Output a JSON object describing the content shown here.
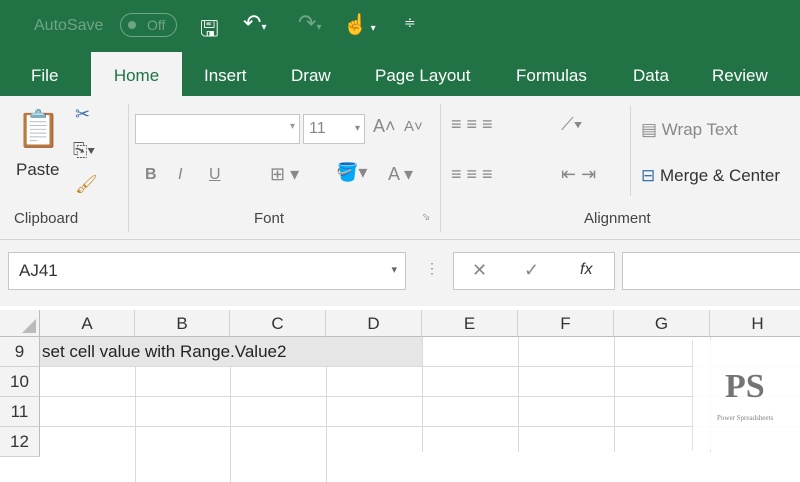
{
  "qat": {
    "autosave": "AutoSave",
    "toggle": "Off"
  },
  "tabs": [
    "File",
    "Home",
    "Insert",
    "Draw",
    "Page Layout",
    "Formulas",
    "Data",
    "Review"
  ],
  "ribbon": {
    "paste": "Paste",
    "clipboard": "Clipboard",
    "font": "Font",
    "alignment": "Alignment",
    "font_size": "11",
    "wrap_text": "Wrap Text",
    "merge_center": "Merge & Center",
    "bold": "B",
    "italic": "I",
    "underline": "U"
  },
  "formula_bar": {
    "name_box": "AJ41",
    "fx": "fx",
    "value": ""
  },
  "columns": [
    "A",
    "B",
    "C",
    "D",
    "E",
    "F",
    "G",
    "H"
  ],
  "rows": [
    {
      "num": "9",
      "a": "set cell value with Range.Value2"
    },
    {
      "num": "10",
      "a": ""
    },
    {
      "num": "11",
      "a": ""
    },
    {
      "num": "12",
      "a": ""
    }
  ],
  "logo": {
    "initials": "PS",
    "name": "Power Spreadsheets"
  }
}
